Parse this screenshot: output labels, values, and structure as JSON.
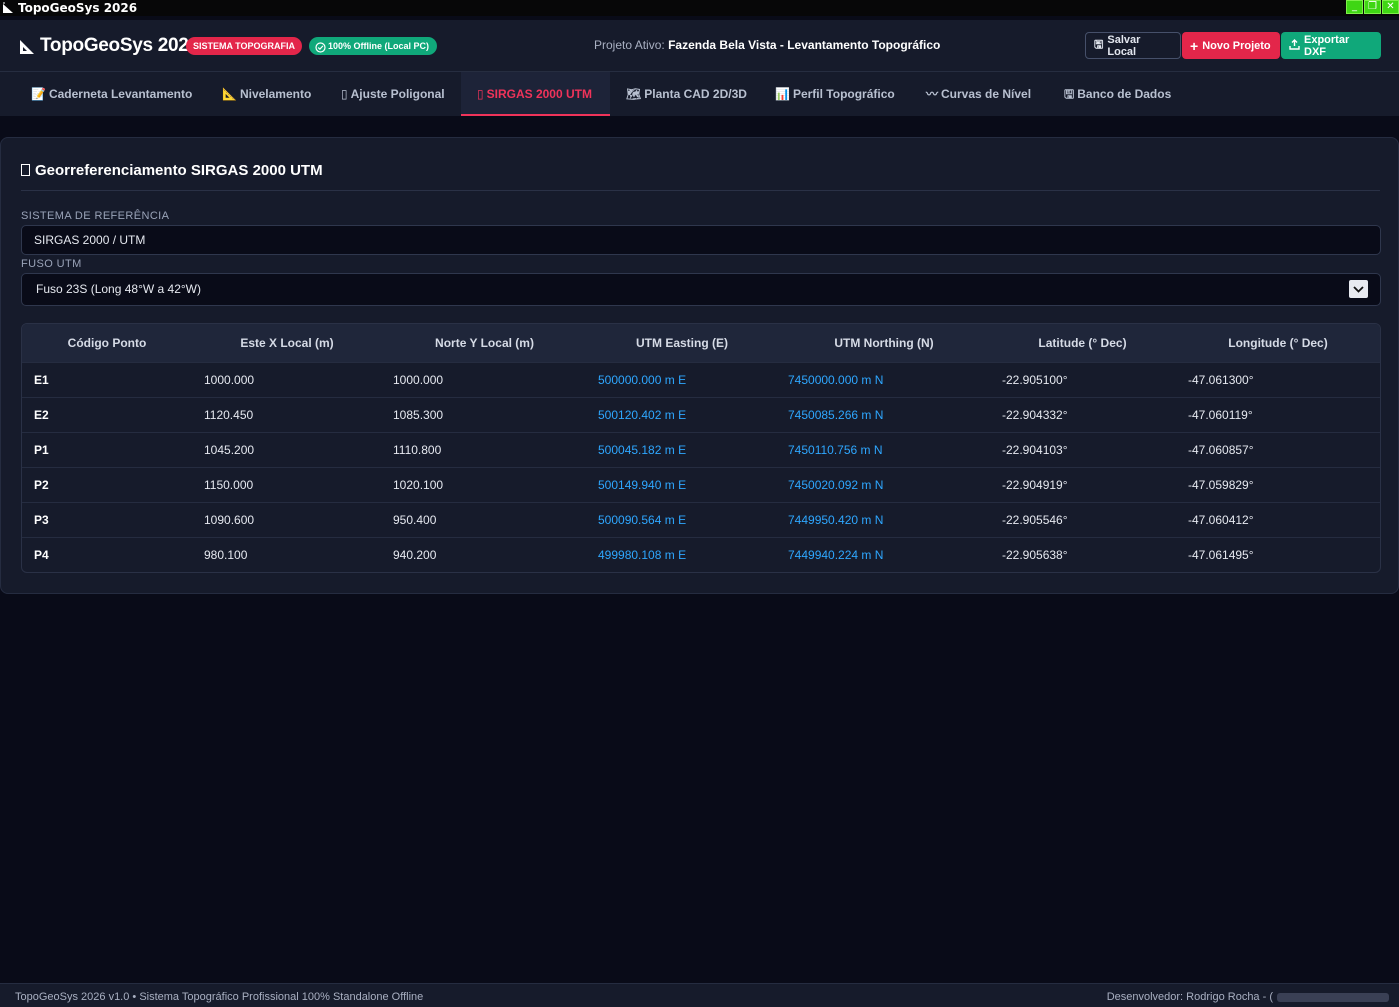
{
  "window": {
    "title": "TopoGeoSys 2026"
  },
  "header": {
    "brand": "TopoGeoSys 2026",
    "badge_system": "SISTEMA TOPOGRAFIA",
    "badge_offline": "100% Offline (Local PC)",
    "project_label": "Projeto Ativo:",
    "project_name": "Fazenda Bela Vista - Levantamento Topográfico",
    "save_label": "Salvar Local",
    "new_label": "Novo Projeto",
    "export_label": "Exportar DXF"
  },
  "tabs": [
    {
      "label": "Caderneta Levantamento",
      "icon": "notebook-icon"
    },
    {
      "label": "Nivelamento",
      "icon": "level-icon"
    },
    {
      "label": "Ajuste Poligonal",
      "icon": "polygon-icon"
    },
    {
      "label": "SIRGAS 2000 UTM",
      "icon": "globe-icon",
      "active": true
    },
    {
      "label": "Planta CAD 2D/3D",
      "icon": "cad-icon"
    },
    {
      "label": "Perfil Topográfico",
      "icon": "profile-chart-icon"
    },
    {
      "label": "Curvas de Nível",
      "icon": "contour-icon"
    },
    {
      "label": "Banco de Dados",
      "icon": "database-icon"
    }
  ],
  "section": {
    "title": "Georreferenciamento SIRGAS 2000 UTM",
    "ref_label": "SISTEMA DE REFERÊNCIA",
    "ref_value": "SIRGAS 2000 / UTM",
    "zone_label": "FUSO UTM",
    "zone_value": "Fuso 23S (Long 48°W a 42°W)"
  },
  "table": {
    "headers": [
      "Código Ponto",
      "Este X Local (m)",
      "Norte Y Local (m)",
      "UTM Easting (E)",
      "UTM Northing (N)",
      "Latitude (° Dec)",
      "Longitude (° Dec)"
    ],
    "rows": [
      [
        "E1",
        "1000.000",
        "1000.000",
        "500000.000 m E",
        "7450000.000 m N",
        "-22.905100°",
        "-47.061300°"
      ],
      [
        "E2",
        "1120.450",
        "1085.300",
        "500120.402 m E",
        "7450085.266 m N",
        "-22.904332°",
        "-47.060119°"
      ],
      [
        "P1",
        "1045.200",
        "1110.800",
        "500045.182 m E",
        "7450110.756 m N",
        "-22.904103°",
        "-47.060857°"
      ],
      [
        "P2",
        "1150.000",
        "1020.100",
        "500149.940 m E",
        "7450020.092 m N",
        "-22.904919°",
        "-47.059829°"
      ],
      [
        "P3",
        "1090.600",
        "950.400",
        "500090.564 m E",
        "7449950.420 m N",
        "-22.905546°",
        "-47.060412°"
      ],
      [
        "P4",
        "980.100",
        "940.200",
        "499980.108 m E",
        "7449940.224 m N",
        "-22.905638°",
        "-47.061495°"
      ]
    ]
  },
  "footer": {
    "left": "TopoGeoSys 2026 v1.0 • Sistema Topográfico Profissional 100% Standalone Offline",
    "right": "Desenvolvedor: Rodrigo Rocha - ("
  },
  "colors": {
    "accent_red": "#e3264a",
    "accent_green": "#10a87a",
    "link_blue": "#2ea7ff",
    "bg": "#090b18",
    "panel": "#161b2b"
  }
}
